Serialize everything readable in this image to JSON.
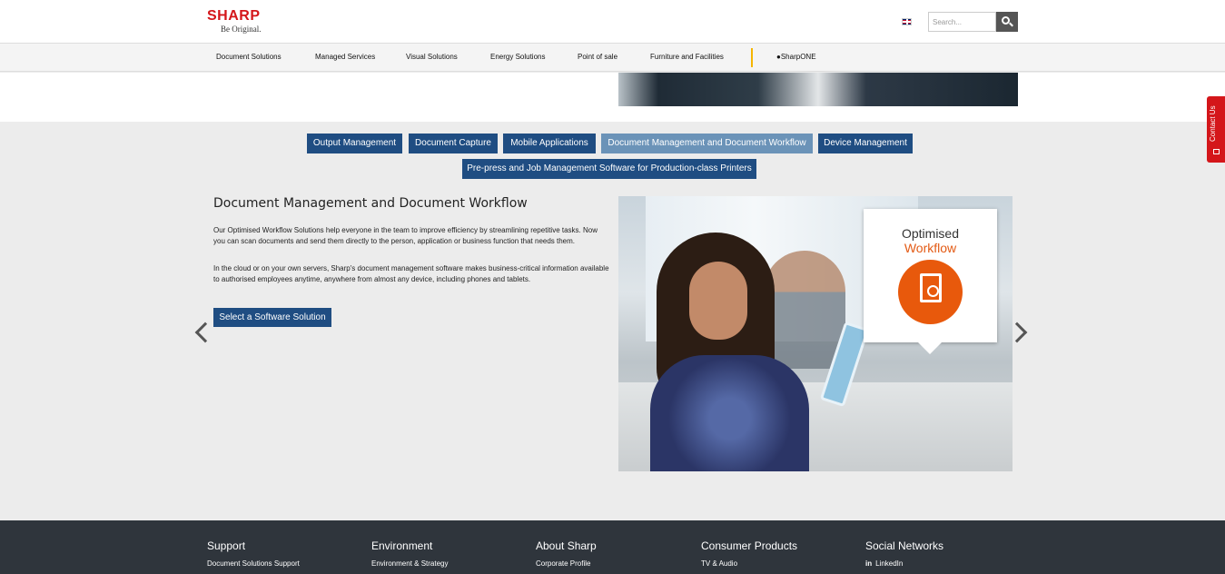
{
  "header": {
    "logo_word": "SHARP",
    "logo_tagline": "Be Original.",
    "language_flag": "uk-flag-icon",
    "search_placeholder": "Search...",
    "search_icon": "search-icon"
  },
  "nav": {
    "items": [
      {
        "label": "Document Solutions"
      },
      {
        "label": "Managed Services"
      },
      {
        "label": "Visual Solutions"
      },
      {
        "label": "Energy Solutions"
      },
      {
        "label": "Point of sale"
      },
      {
        "label": "Furniture and Facilities"
      }
    ],
    "user_label": "SharpONE",
    "user_icon": "user-icon",
    "separator_color": "#f5b500"
  },
  "contact": {
    "label": "Contact Us",
    "icon": "mail-icon"
  },
  "tabs": {
    "items": [
      {
        "label": "Output Management",
        "active": false
      },
      {
        "label": "Document Capture",
        "active": false
      },
      {
        "label": "Mobile Applications",
        "active": false
      },
      {
        "label": "Document Management and Document Workflow",
        "active": true
      },
      {
        "label": "Device Management",
        "active": false
      },
      {
        "label": "Pre-press and Job Management Software for Production-class Printers",
        "active": false
      }
    ]
  },
  "content": {
    "title": "Document Management and Document Workflow",
    "paragraph_1": "Our Optimised Workflow Solutions help everyone in the team to improve efficiency by streamlining repetitive tasks. Now you can scan documents and send them directly to the person, application or business function that needs them.",
    "paragraph_2": "In the cloud or on your own servers, Sharp's document management software makes business-critical information available to authorised employees anytime, anywhere from almost any device, including phones and tablets.",
    "cta_label": "Select a Software Solution",
    "prev_icon": "chevron-left-icon",
    "next_icon": "chevron-right-icon"
  },
  "callout": {
    "line1": "Optimised",
    "line2": "Workflow",
    "icon": "document-refresh-icon"
  },
  "footer": {
    "columns": [
      {
        "heading": "Support",
        "link": "Document Solutions Support"
      },
      {
        "heading": "Environment",
        "link": "Environment & Strategy"
      },
      {
        "heading": "About Sharp",
        "link": "Corporate Profile"
      },
      {
        "heading": "Consumer Products",
        "link": "TV & Audio"
      },
      {
        "heading": "Social Networks",
        "link": "LinkedIn",
        "link_icon": "linkedin-icon"
      }
    ]
  },
  "colors": {
    "brand_red": "#d4161a",
    "tab_blue": "#1f4d82",
    "tab_active": "#6b93b8",
    "accent_orange": "#e8590c",
    "footer_bg": "#2f353c"
  }
}
